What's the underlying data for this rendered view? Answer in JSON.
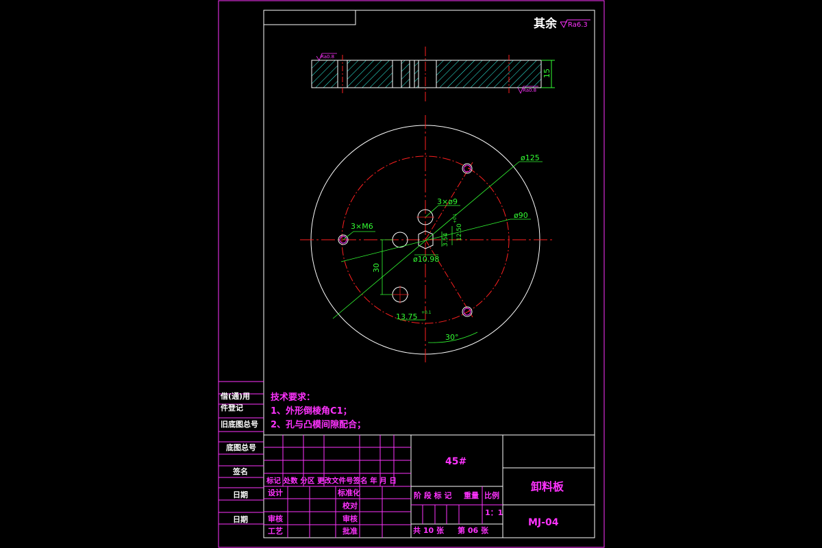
{
  "header": {
    "roughness_prefix": "其余",
    "roughness_value": "Ra6.3"
  },
  "side_view": {
    "roughness_top": "Ra0.8",
    "roughness_bottom": "Ra0.8",
    "thickness_dim": "15"
  },
  "plan_view": {
    "dia_outer": "ø125",
    "dia_pitch": "ø90",
    "holes_9": "3×ø9",
    "holes_m6": "3×M6",
    "dim_12": "12.50",
    "dim_12_tol": "+0.1",
    "dim_small": "3.54",
    "dim_1098": "ø10.98",
    "dim_30": "30",
    "dim_1375": "13.75",
    "dim_1375_tol": "+0.1",
    "angle": "30°"
  },
  "tech_requirements": {
    "title": "技术要求：",
    "line1": "1、外形倒棱角C1；",
    "line2": "2、孔与凸模间隙配合；"
  },
  "side_labels": {
    "l1": "借(通)用",
    "l2": "件登记",
    "l3": "旧底图总号",
    "l4": "底图总号",
    "l5": "签名",
    "l6": "日期",
    "l7": "日期"
  },
  "title_block": {
    "material": "45#",
    "part_name": "卸料板",
    "drawing_no": "MJ-04",
    "rev_headers": "标记 处数 分区 更改文件号签名 年 月 日",
    "design": "设计",
    "standardization": "标准化",
    "review": "审核",
    "process": "工艺",
    "check": "校对",
    "study": "审核",
    "approve": "批准",
    "hdr_stage": "阶 段 标 记",
    "hdr_weight": "重量",
    "hdr_scale": "比例",
    "scale": "1：1",
    "total_sheets": "共 10 张",
    "sheet_no": "第 06 张"
  },
  "colors": {
    "frame": "#ff33ff",
    "dimension": "#33ff33",
    "outline": "#ffffff",
    "centerline": "#ff2020",
    "hatch": "#33ffee"
  }
}
